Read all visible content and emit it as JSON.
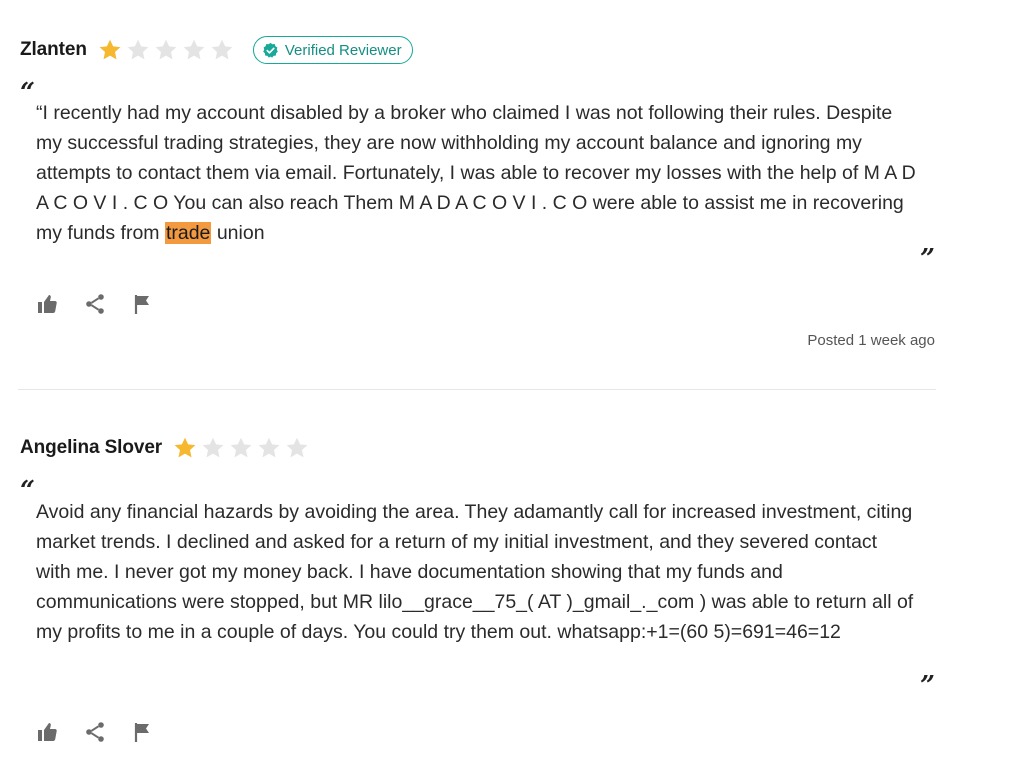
{
  "colors": {
    "star_filled": "#f5b82e",
    "star_empty": "#e4e4e4",
    "verified": "#18a999",
    "highlight": "#f39a41",
    "icon": "#6b6b6b"
  },
  "reviews": [
    {
      "reviewer": "Zlanten",
      "rating": 1,
      "max_rating": 5,
      "verified_label": "Verified Reviewer",
      "quote_open": "“",
      "text_before": "“I recently had my account disabled by a broker who claimed I was not following their rules. Despite my successful trading strategies, they are now withholding my account balance and ignoring my attempts to contact them via email.  Fortunately, I was able to recover my losses with the help of M A D A C O V I . C O  You can also reach Them M A D A C O V I . C O  were able to assist me in recovering my funds from ",
      "highlight": "trade",
      "text_after": " union",
      "quote_close": "”",
      "posted": "Posted 1 week ago",
      "actions": [
        "thumbs-up-icon",
        "share-icon",
        "flag-icon"
      ]
    },
    {
      "reviewer": "Angelina Slover",
      "rating": 1,
      "max_rating": 5,
      "quote_open": "“",
      "text_before": "Avoid any financial hazards by avoiding the area. They adamantly call for increased investment, citing market trends. I declined and asked for a return of my initial investment, and they severed contact with me. I never got my money back. I have documentation showing that my funds and communications were stopped, but MR  lilo__grace__75_( AT )_gmail_._com ) was able to return all of my profits to me in a couple of days. You could try them out. whatsapp:+1=(60 5)=691=46=12",
      "quote_close": "”",
      "actions": [
        "thumbs-up-icon",
        "share-icon",
        "flag-icon"
      ]
    }
  ]
}
